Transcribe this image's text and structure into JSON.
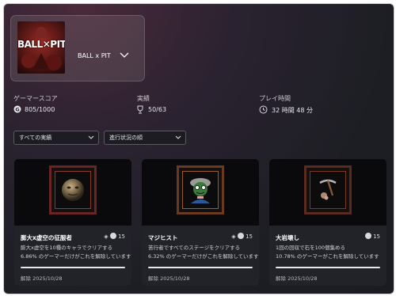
{
  "game": {
    "title": "BALL x PIT",
    "cover_logo": "BALL✕PIT"
  },
  "stats": {
    "gamerscore_label": "ゲーマースコア",
    "gamerscore_value": "805/1000",
    "achievements_label": "実績",
    "achievements_value": "50/63",
    "playtime_label": "プレイ時間",
    "playtime_value": "32 時間 48 分"
  },
  "filters": {
    "achievement_filter": "すべての実績",
    "sort_order": "進行状況の順"
  },
  "achievements": [
    {
      "title": "膨大x虚空の征服者",
      "gamerscore": "15",
      "rarity_icon": "diamond-icon",
      "description": "膨大x虚空を10種のキャラでクリアする",
      "percent_text": "6.86% のゲーマーだけがこれを解除しています",
      "unlocked": "解除 2025/10/28",
      "progress": 1.0
    },
    {
      "title": "マジヒスト",
      "gamerscore": "15",
      "rarity_icon": "diamond-icon",
      "description": "苦行者ですべてのステージをクリアする",
      "percent_text": "6.32% のゲーマーだけがこれを解除しています",
      "unlocked": "解除 2025/10/28",
      "progress": 1.0
    },
    {
      "title": "大岩壊し",
      "gamerscore": "15",
      "rarity_icon": "",
      "description": "1回の回収で石を100個集める",
      "percent_text": "10.78% のゲーマーがこれを解除しています",
      "unlocked": "解除 2025/10/28",
      "progress": 1.0
    }
  ]
}
